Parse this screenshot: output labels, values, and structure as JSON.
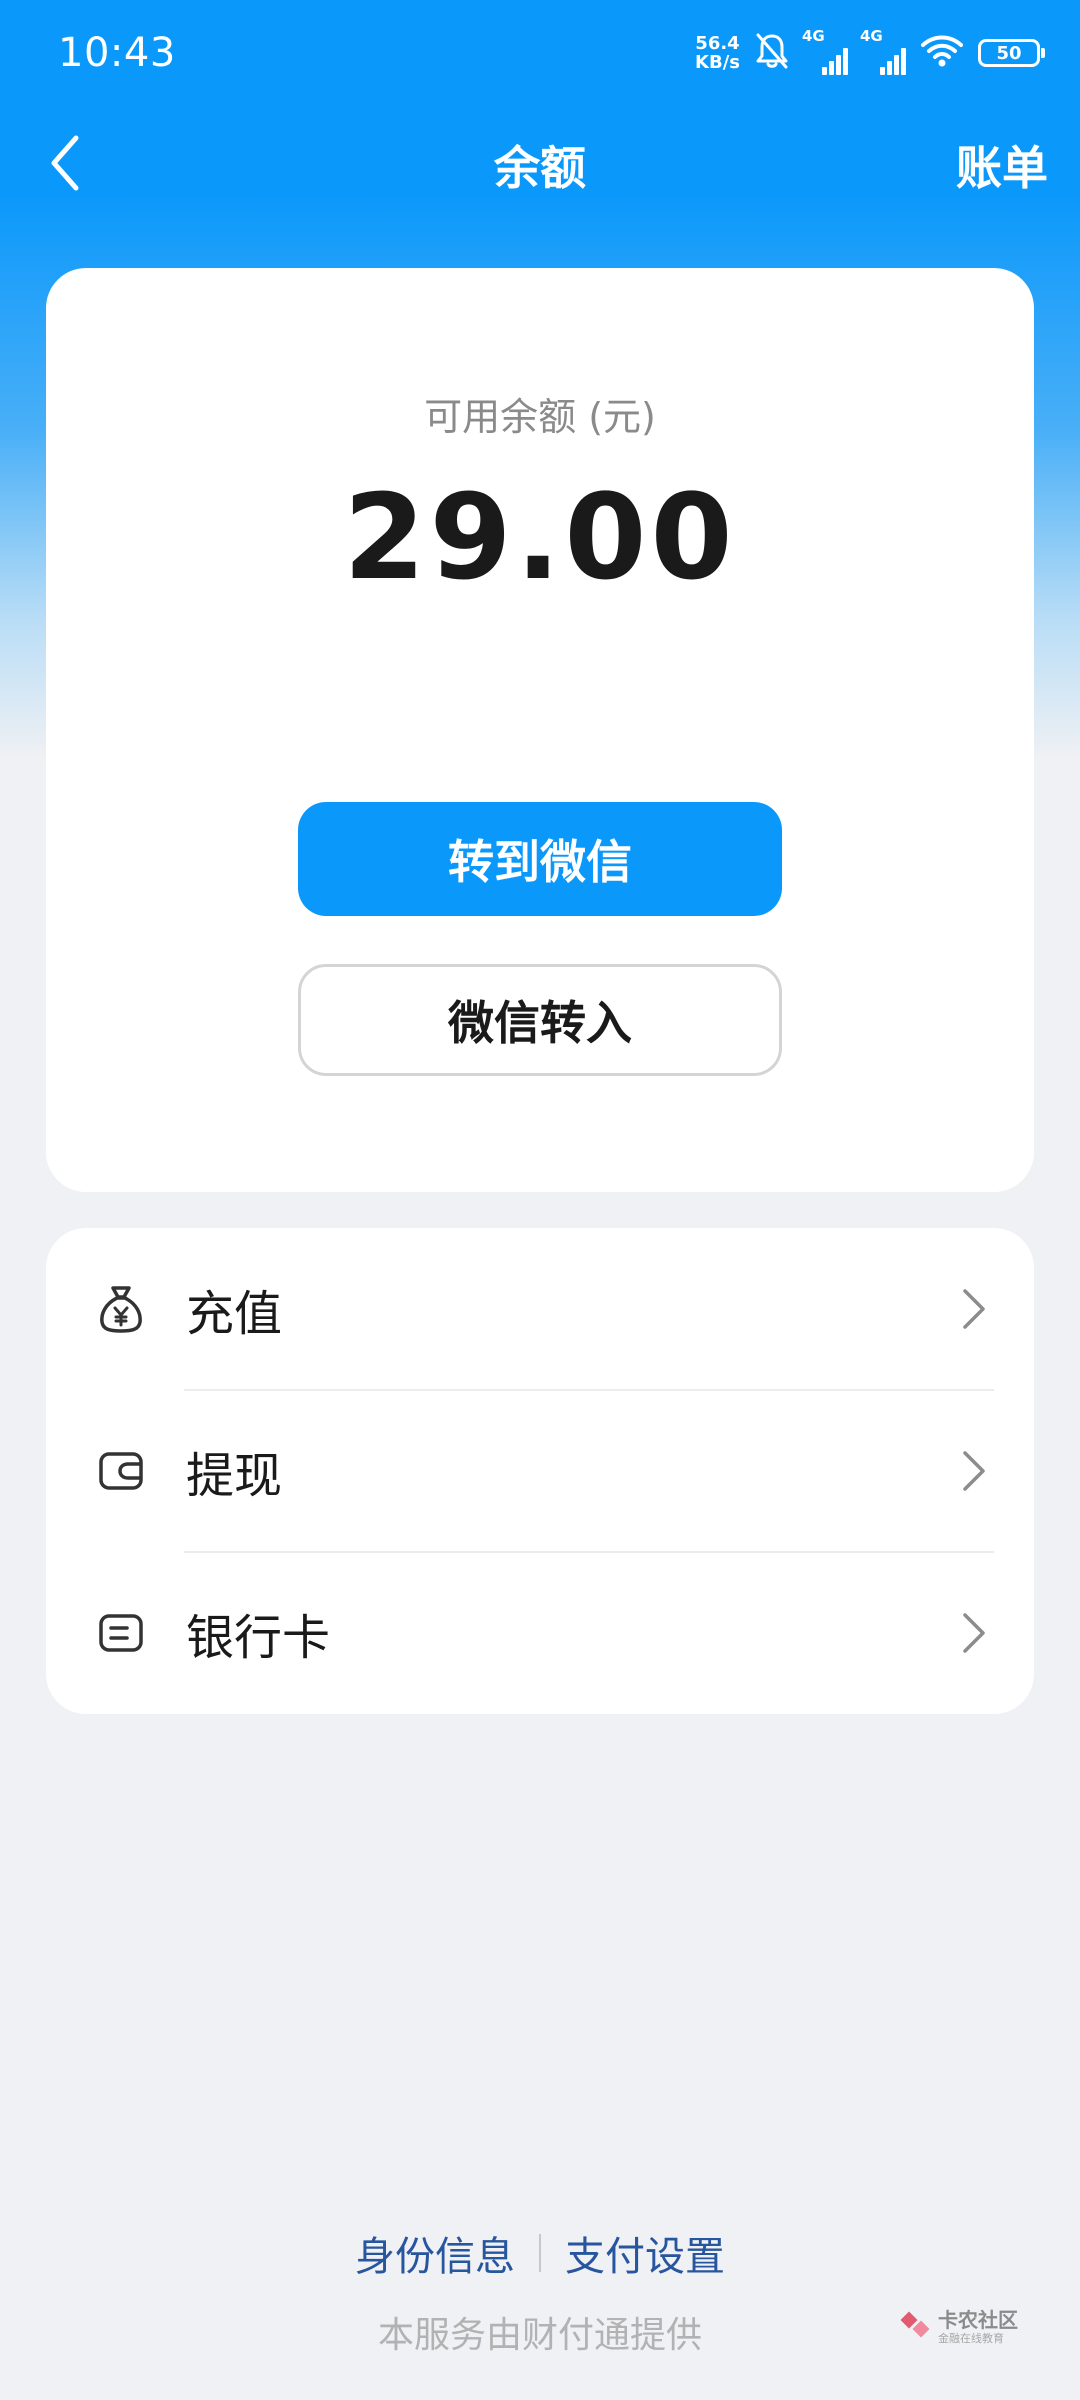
{
  "status_bar": {
    "time": "10:43",
    "net_speed_value": "56.4",
    "net_speed_unit": "KB/s",
    "signal1_label": "4G",
    "signal2_label": "4G",
    "battery": "50"
  },
  "nav": {
    "title": "余额",
    "right_action": "账单",
    "back_icon": "chevron-left-icon"
  },
  "balance": {
    "label": "可用余额 (元)",
    "amount": "29.00",
    "primary_button": "转到微信",
    "secondary_button": "微信转入"
  },
  "menu": {
    "items": [
      {
        "label": "充值",
        "icon": "money-bag-icon"
      },
      {
        "label": "提现",
        "icon": "wallet-icon"
      },
      {
        "label": "银行卡",
        "icon": "bank-card-icon"
      }
    ]
  },
  "footer": {
    "link_identity": "身份信息",
    "link_payment_settings": "支付设置",
    "provider_note": "本服务由财付通提供"
  },
  "watermark": {
    "main": "卡农社区",
    "sub": "金融在线教育"
  },
  "colors": {
    "accent": "#0A98FB",
    "page_bg": "#F0F1F4",
    "link": "#27559E"
  }
}
